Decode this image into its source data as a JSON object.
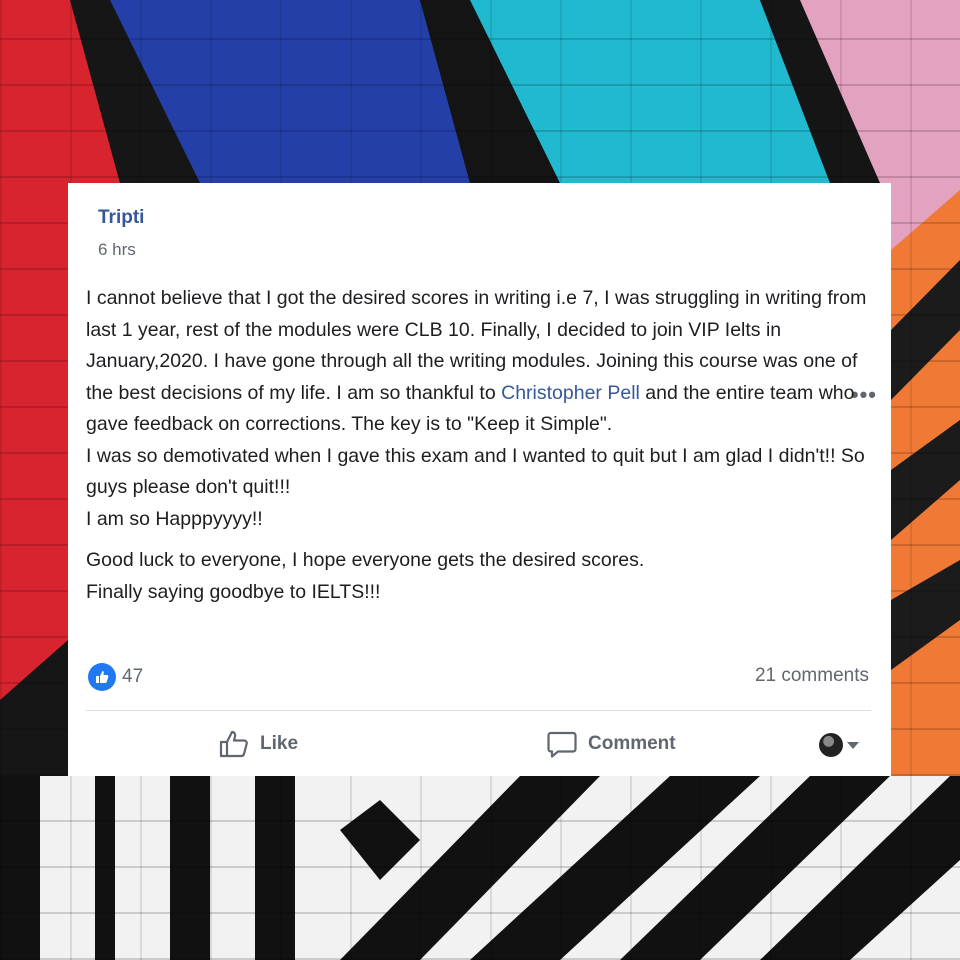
{
  "post": {
    "author": "Tripti",
    "time": "6 hrs",
    "paragraphs": {
      "p1_before": "I cannot believe that I got the desired scores in writing i.e 7, I was struggling in writing from last 1 year, rest of the modules were CLB 10. Finally, I decided to join VIP Ielts in January,2020. I have gone through all the writing modules. Joining this course was one of the best decisions of my life. I am so thankful to ",
      "p1_mention": "Christopher Pell",
      "p1_after": " and the entire team who gave feedback on corrections. The key is to \"Keep it Simple\".",
      "p2": "I was so demotivated when I gave this exam and I wanted to quit but I am glad I didn't!! So guys please don't quit!!!",
      "p3": "I am so Happpyyyy!!",
      "p4": "Good luck to everyone, I hope everyone gets the desired scores.",
      "p5": "Finally saying goodbye to IELTS!!!"
    },
    "reaction_count": "47",
    "comments_count": "21 comments",
    "actions": {
      "like": "Like",
      "comment": "Comment"
    },
    "icons": {
      "more": "more-options-icon",
      "reaction": "like-reaction-icon",
      "like": "thumbs-up-icon",
      "comment": "comment-bubble-icon",
      "share_avatar": "avatar-icon",
      "caret": "chevron-down-icon"
    },
    "colors": {
      "link": "#365899",
      "like_blue": "#2078f4",
      "text": "#1c1e21",
      "muted": "#616770"
    }
  }
}
